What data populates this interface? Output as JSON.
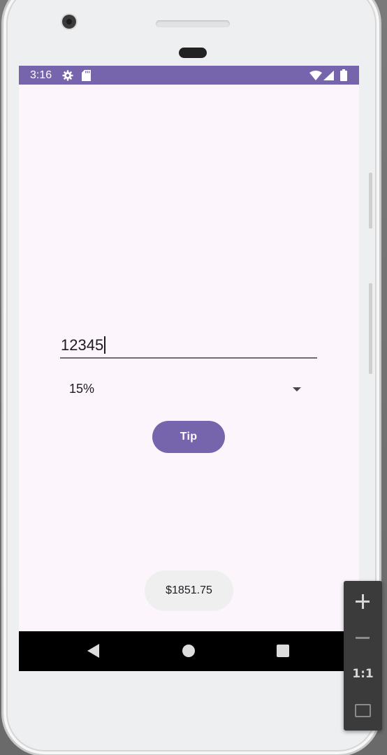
{
  "status_bar": {
    "time": "3:16",
    "icons": [
      "settings-icon",
      "sd-card-icon",
      "wifi-icon",
      "signal-icon",
      "battery-icon"
    ],
    "background_color": "#7665ad"
  },
  "form": {
    "amount_value": "12345",
    "tip_percent_selected": "15%",
    "tip_button_label": "Tip"
  },
  "toast": {
    "text": "$1851.75"
  },
  "navigation": {
    "buttons": [
      "back-icon",
      "home-icon",
      "recents-icon"
    ]
  },
  "zoom_toolbar": {
    "zoom_in_symbol": "+",
    "zoom_out_symbol": "−",
    "actual_size_label": "1:1",
    "fit_icon": "fit-screen-icon"
  },
  "colors": {
    "accent": "#7665ad",
    "screen_background": "#fcf6fc",
    "toast_background": "#f0eff0"
  }
}
